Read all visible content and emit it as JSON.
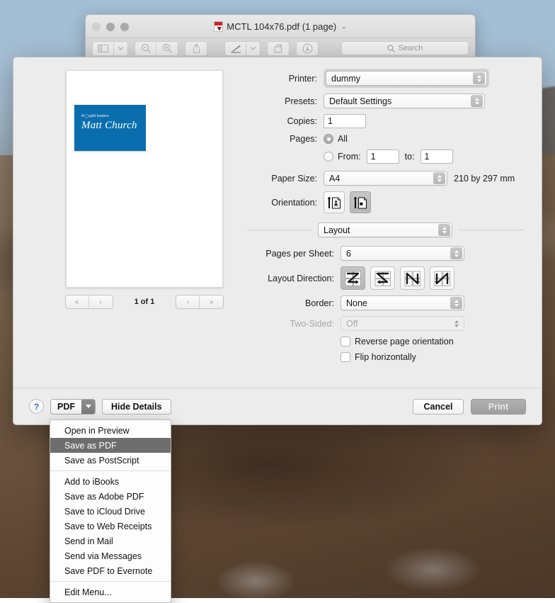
{
  "window": {
    "title": "MCTL 104x76.pdf (1 page)",
    "title_chevron": "⌄",
    "file_icon": "pdf-file-icon",
    "traffic_lights": [
      "close",
      "minimize",
      "zoom"
    ],
    "toolbar": {
      "sidebar_label": "sidebar-view",
      "zoom_out_label": "zoom-out",
      "zoom_in_label": "zoom-in",
      "share_label": "share",
      "markup_label": "markup-pen",
      "markup_chevron": "⌄",
      "rotate_label": "rotate",
      "annotate_label": "annotate",
      "search_placeholder": "Search"
    }
  },
  "preview": {
    "document": {
      "tagline": "th◯ught leaders",
      "name": "Matt Church",
      "card_color": "#0a6eae"
    },
    "nav": {
      "first": "«",
      "prev": "‹",
      "next": "›",
      "last": "»",
      "page_count": "1 of 1"
    }
  },
  "settings": {
    "printer": {
      "label": "Printer:",
      "value": "dummy"
    },
    "presets": {
      "label": "Presets:",
      "value": "Default Settings"
    },
    "copies": {
      "label": "Copies:",
      "value": "1"
    },
    "pages": {
      "label": "Pages:",
      "all_label": "All",
      "all_selected": true,
      "from_label": "From:",
      "from_value": "1",
      "to_label": "to:",
      "to_value": "1"
    },
    "paper_size": {
      "label": "Paper Size:",
      "value": "A4",
      "dimensions": "210 by 297 mm"
    },
    "orientation": {
      "label": "Orientation:",
      "options": [
        {
          "name": "portrait",
          "selected": false
        },
        {
          "name": "landscape",
          "selected": true
        }
      ]
    },
    "pane": {
      "value": "Layout"
    },
    "pages_per_sheet": {
      "label": "Pages per Sheet:",
      "value": "6"
    },
    "layout_direction": {
      "label": "Layout Direction:",
      "options": [
        {
          "name": "z-left-right",
          "selected": true
        },
        {
          "name": "z-right-left",
          "selected": false
        },
        {
          "name": "n-down-right",
          "selected": false
        },
        {
          "name": "n-down-left",
          "selected": false
        }
      ]
    },
    "border": {
      "label": "Border:",
      "value": "None"
    },
    "two_sided": {
      "label": "Two-Sided:",
      "value": "Off",
      "disabled": true
    },
    "reverse_page_orientation": {
      "label": "Reverse page orientation",
      "checked": false
    },
    "flip_horizontally": {
      "label": "Flip horizontally",
      "checked": false
    }
  },
  "bottom_bar": {
    "help_label": "?",
    "pdf_label": "PDF",
    "hide_details_label": "Hide Details",
    "cancel_label": "Cancel",
    "print_label": "Print"
  },
  "pdf_menu": {
    "groups": [
      [
        {
          "label": "Open in Preview",
          "selected": false
        },
        {
          "label": "Save as PDF",
          "selected": true
        },
        {
          "label": "Save as PostScript",
          "selected": false
        }
      ],
      [
        {
          "label": "Add to iBooks",
          "selected": false
        },
        {
          "label": "Save as Adobe PDF",
          "selected": false
        },
        {
          "label": "Save to iCloud Drive",
          "selected": false
        },
        {
          "label": "Save to Web Receipts",
          "selected": false
        },
        {
          "label": "Send in Mail",
          "selected": false
        },
        {
          "label": "Send via Messages",
          "selected": false
        },
        {
          "label": "Save PDF to Evernote",
          "selected": false
        }
      ],
      [
        {
          "label": "Edit Menu...",
          "selected": false
        }
      ]
    ]
  }
}
